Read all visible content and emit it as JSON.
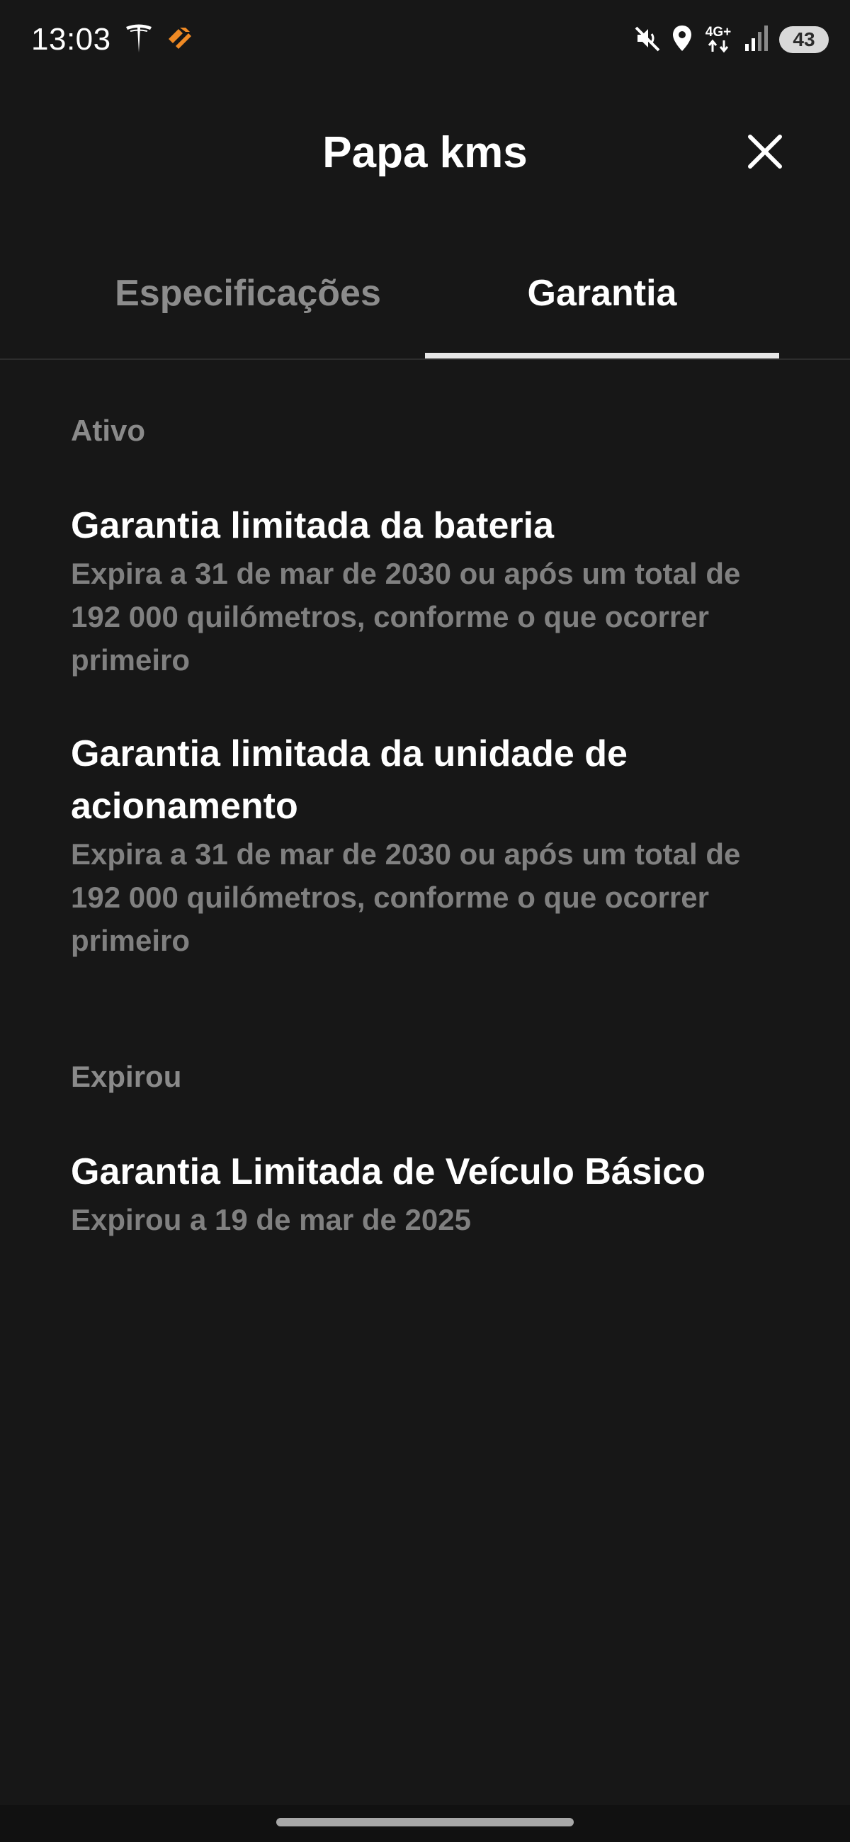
{
  "status_bar": {
    "time": "13:03",
    "network": "4G+",
    "battery": "43",
    "icons": [
      "tesla-logo-icon",
      "app-notification-icon",
      "mute-icon",
      "location-icon",
      "network-4g-icon",
      "signal-icon",
      "battery-icon"
    ],
    "colors": {
      "app_notification": "#f08a24"
    }
  },
  "header": {
    "title": "Papa kms",
    "close_icon": "close-icon"
  },
  "tabs": [
    {
      "label": "Especificações",
      "active": false
    },
    {
      "label": "Garantia",
      "active": true
    }
  ],
  "sections": {
    "active": {
      "title": "Ativo",
      "items": [
        {
          "name": "Garantia limitada da bateria",
          "description": "Expira a 31 de mar de 2030 ou após um total de 192 000 quilómetros, conforme o que ocorrer primeiro"
        },
        {
          "name": "Garantia limitada da unidade de acionamento",
          "description": "Expira a 31 de mar de 2030 ou após um total de 192 000 quilómetros, conforme o que ocorrer primeiro"
        }
      ]
    },
    "expired": {
      "title": "Expirou",
      "items": [
        {
          "name": "Garantia Limitada de Veículo Básico",
          "description": "Expirou a 19 de mar de 2025"
        }
      ]
    }
  },
  "theme": {
    "background": "#171717",
    "primary_text": "#ffffff",
    "secondary_text": "#808080"
  }
}
